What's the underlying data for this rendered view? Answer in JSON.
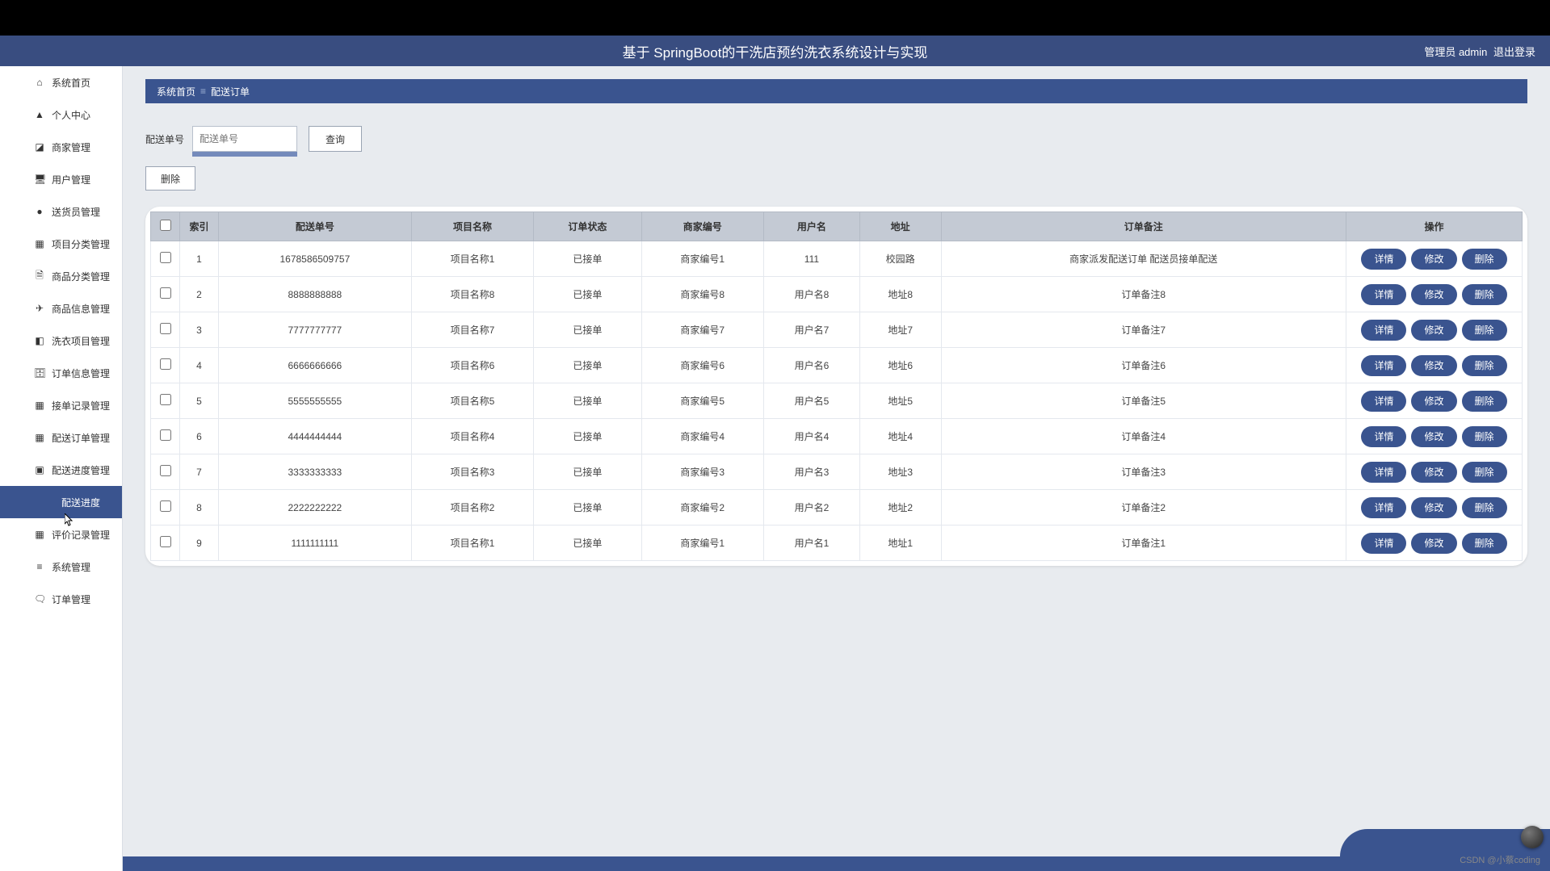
{
  "header": {
    "title": "基于 SpringBoot的干洗店预约洗衣系统设计与实现",
    "user_prefix": "管理员 admin",
    "logout": "退出登录"
  },
  "sidebar": {
    "items": [
      {
        "icon": "⌂",
        "label": "系统首页"
      },
      {
        "icon": "▲",
        "label": "个人中心"
      },
      {
        "icon": "◪",
        "label": "商家管理"
      },
      {
        "icon": "🖥",
        "label": "用户管理"
      },
      {
        "icon": "●",
        "label": "送货员管理"
      },
      {
        "icon": "▦",
        "label": "项目分类管理"
      },
      {
        "icon": "🗎",
        "label": "商品分类管理"
      },
      {
        "icon": "✈",
        "label": "商品信息管理"
      },
      {
        "icon": "◧",
        "label": "洗衣项目管理"
      },
      {
        "icon": "🗄",
        "label": "订单信息管理"
      },
      {
        "icon": "▦",
        "label": "接单记录管理"
      },
      {
        "icon": "▦",
        "label": "配送订单管理"
      },
      {
        "icon": "▣",
        "label": "配送进度管理"
      },
      {
        "icon": "",
        "label": "配送进度",
        "active": true,
        "sub": true
      },
      {
        "icon": "▦",
        "label": "评价记录管理"
      },
      {
        "icon": "≡",
        "label": "系统管理"
      },
      {
        "icon": "🗨",
        "label": "订单管理"
      }
    ]
  },
  "breadcrumb": {
    "home": "系统首页",
    "sep": "≡",
    "page": "配送订单"
  },
  "search": {
    "label": "配送单号",
    "placeholder": "配送单号",
    "btn": "查询"
  },
  "delete_btn": "删除",
  "table": {
    "headers": [
      "",
      "索引",
      "配送单号",
      "项目名称",
      "订单状态",
      "商家编号",
      "用户名",
      "地址",
      "订单备注",
      "操作"
    ],
    "actions": {
      "detail": "详情",
      "edit": "修改",
      "del": "删除"
    },
    "rows": [
      {
        "idx": "1",
        "no": "1678586509757",
        "proj": "项目名称1",
        "status": "已接单",
        "merchant": "商家编号1",
        "user": "111",
        "addr": "校园路",
        "note": "商家派发配送订单 配送员接单配送"
      },
      {
        "idx": "2",
        "no": "8888888888",
        "proj": "项目名称8",
        "status": "已接单",
        "merchant": "商家编号8",
        "user": "用户名8",
        "addr": "地址8",
        "note": "订单备注8"
      },
      {
        "idx": "3",
        "no": "7777777777",
        "proj": "项目名称7",
        "status": "已接单",
        "merchant": "商家编号7",
        "user": "用户名7",
        "addr": "地址7",
        "note": "订单备注7"
      },
      {
        "idx": "4",
        "no": "6666666666",
        "proj": "项目名称6",
        "status": "已接单",
        "merchant": "商家编号6",
        "user": "用户名6",
        "addr": "地址6",
        "note": "订单备注6"
      },
      {
        "idx": "5",
        "no": "5555555555",
        "proj": "项目名称5",
        "status": "已接单",
        "merchant": "商家编号5",
        "user": "用户名5",
        "addr": "地址5",
        "note": "订单备注5"
      },
      {
        "idx": "6",
        "no": "4444444444",
        "proj": "项目名称4",
        "status": "已接单",
        "merchant": "商家编号4",
        "user": "用户名4",
        "addr": "地址4",
        "note": "订单备注4"
      },
      {
        "idx": "7",
        "no": "3333333333",
        "proj": "项目名称3",
        "status": "已接单",
        "merchant": "商家编号3",
        "user": "用户名3",
        "addr": "地址3",
        "note": "订单备注3"
      },
      {
        "idx": "8",
        "no": "2222222222",
        "proj": "项目名称2",
        "status": "已接单",
        "merchant": "商家编号2",
        "user": "用户名2",
        "addr": "地址2",
        "note": "订单备注2"
      },
      {
        "idx": "9",
        "no": "1111111111",
        "proj": "项目名称1",
        "status": "已接单",
        "merchant": "商家编号1",
        "user": "用户名1",
        "addr": "地址1",
        "note": "订单备注1"
      }
    ]
  },
  "watermark": "CSDN @小蔡coding"
}
